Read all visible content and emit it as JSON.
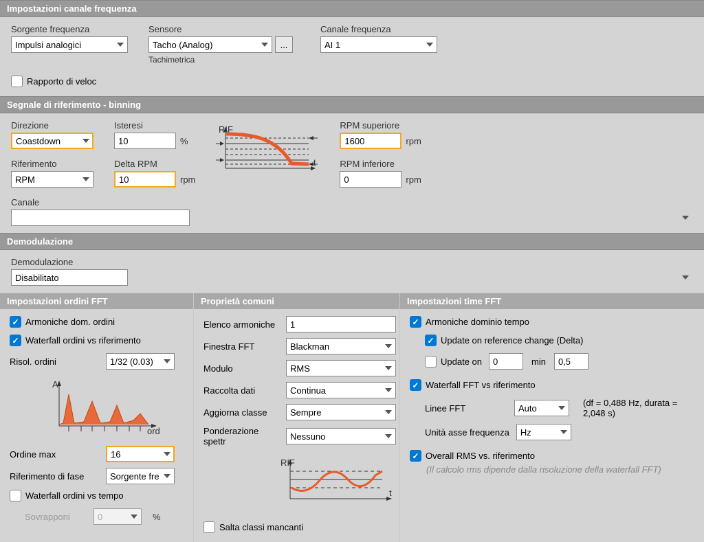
{
  "freq_settings": {
    "header": "Impostazioni canale frequenza",
    "source_label": "Sorgente frequenza",
    "source_value": "Impulsi analogici",
    "sensor_label": "Sensore",
    "sensor_value": "Tacho (Analog)",
    "sensor_helper": "Tachimetrica",
    "channel_label": "Canale frequenza",
    "channel_value": "AI 1",
    "ratio_label": "Rapporto di veloc"
  },
  "binning": {
    "header": "Segnale di riferimento - binning",
    "direction_label": "Direzione",
    "direction_value": "Coastdown",
    "hysteresis_label": "Isteresi",
    "hysteresis_value": "10",
    "hysteresis_unit": "%",
    "reference_label": "Riferimento",
    "reference_value": "RPM",
    "delta_label": "Delta RPM",
    "delta_value": "10",
    "delta_unit": "rpm",
    "upper_label": "RPM superiore",
    "upper_value": "1600",
    "upper_unit": "rpm",
    "lower_label": "RPM inferiore",
    "lower_value": "0",
    "lower_unit": "rpm",
    "channel_label": "Canale",
    "channel_value": ""
  },
  "demod": {
    "header": "Demodulazione",
    "label": "Demodulazione",
    "value": "Disabilitato"
  },
  "orders": {
    "header": "Impostazioni ordini FFT",
    "harmonics_label": "Armoniche dom. ordini",
    "waterfall_ref_label": "Waterfall ordini vs riferimento",
    "resolution_label": "Risol. ordini",
    "resolution_value": "1/32 (0.03)",
    "max_order_label": "Ordine max",
    "max_order_value": "16",
    "phase_ref_label": "Riferimento di fase",
    "phase_ref_value": "Sorgente freq.",
    "waterfall_time_label": "Waterfall ordini vs tempo",
    "overlap_label": "Sovrapponi",
    "overlap_value": "0",
    "overlap_unit": "%"
  },
  "common": {
    "header": "Proprietà comuni",
    "harmonics_list_label": "Elenco armoniche",
    "harmonics_list_value": "1",
    "window_label": "Finestra FFT",
    "window_value": "Blackman",
    "module_label": "Modulo",
    "module_value": "RMS",
    "collection_label": "Raccolta dati",
    "collection_value": "Continua",
    "update_class_label": "Aggiorna classe",
    "update_class_value": "Sempre",
    "weighting_label": "Ponderazione spettr",
    "weighting_value": "Nessuno",
    "skip_label": "Salta classi mancanti"
  },
  "time_fft": {
    "header": "Impostazioni time FFT",
    "time_harmonics_label": "Armoniche dominio tempo",
    "update_ref_label": "Update on reference change (Delta)",
    "update_on_label": "Update on",
    "update_on_value": "0",
    "update_on_unit": "min",
    "update_on_second": "0,5",
    "waterfall_fft_label": "Waterfall FFT vs riferimento",
    "fft_lines_label": "Linee FFT",
    "fft_lines_value": "Auto",
    "fft_info": "(df = 0,488 Hz, durata = 2,048 s)",
    "freq_unit_label": "Unità asse frequenza",
    "freq_unit_value": "Hz",
    "overall_rms_label": "Overall RMS vs. riferimento",
    "overall_rms_note": "(Il calcolo rms dipende dalla risoluzione della waterfall FFT)"
  }
}
